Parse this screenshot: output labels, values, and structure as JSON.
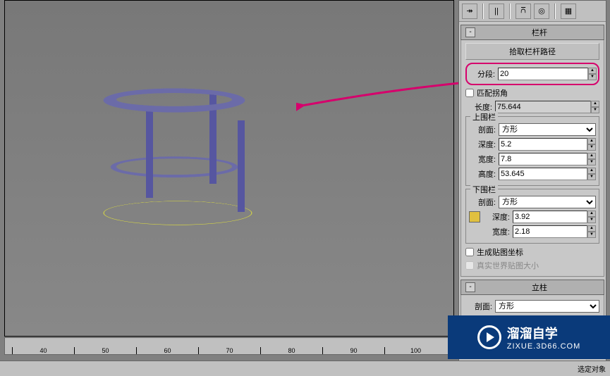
{
  "panel": {
    "railing_title": "栏杆",
    "pick_path_btn": "拾取栏杆路径",
    "segments_label": "分段:",
    "segments_value": "20",
    "match_corners": "匹配拐角",
    "length_label": "长度:",
    "length_value": "75.644",
    "top_rail": {
      "title": "上围栏",
      "profile_label": "剖面:",
      "profile_value": "方形",
      "depth_label": "深度:",
      "depth_value": "5.2",
      "width_label": "宽度:",
      "width_value": "7.8",
      "height_label": "高度:",
      "height_value": "53.645"
    },
    "lower_rail": {
      "title": "下围栏",
      "profile_label": "剖面:",
      "profile_value": "方形",
      "depth_label": "深度:",
      "depth_value": "3.92",
      "width_label": "宽度:",
      "width_value": "2.18"
    },
    "gen_mapping": "生成贴图坐标",
    "real_world": "真实世界贴图大小",
    "posts_title": "立柱",
    "posts_profile_label": "剖面:",
    "posts_profile_value": "方形"
  },
  "ruler": [
    "40",
    "50",
    "60",
    "70",
    "80",
    "90",
    "100"
  ],
  "watermark": {
    "main": "溜溜自学",
    "sub": "ZIXUE.3D66.COM"
  },
  "statusbar": {
    "select_label": "选定对象"
  }
}
